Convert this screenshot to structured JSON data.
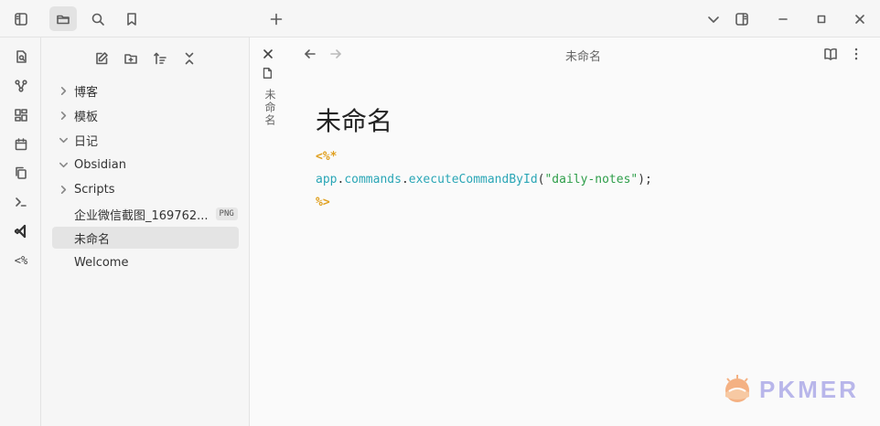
{
  "topbar": {
    "new_tab_label": "+"
  },
  "ribbon": {
    "template_label": "<%"
  },
  "sidebar": {
    "items": [
      {
        "label": "博客",
        "type": "folder",
        "expanded": false
      },
      {
        "label": "模板",
        "type": "folder",
        "expanded": false
      },
      {
        "label": "日记",
        "type": "folder",
        "expanded": true
      },
      {
        "label": "Obsidian",
        "type": "folder",
        "expanded": true
      },
      {
        "label": "Scripts",
        "type": "folder",
        "expanded": false
      },
      {
        "label": "企业微信截图_169762...",
        "type": "file",
        "badge": "PNG"
      },
      {
        "label": "未命名",
        "type": "file",
        "selected": true
      },
      {
        "label": "Welcome",
        "type": "file"
      }
    ]
  },
  "stack": {
    "title": "未命名"
  },
  "editor": {
    "view_title": "未命名",
    "heading": "未命名",
    "code": {
      "open_tag": "<%*",
      "obj": "app",
      "dot1": ".",
      "prop": "commands",
      "dot2": ".",
      "method": "executeCommandById",
      "paren_open": "(",
      "arg": "\"daily-notes\"",
      "paren_close": ");",
      "close_tag": "%>"
    }
  },
  "watermark": {
    "text": "PKMER"
  },
  "colors": {
    "template_tag": "#e0a020",
    "code_identifier": "#2aa6b6",
    "code_string": "#2e9e4a",
    "selected_item_bg": "#e4e4e4"
  }
}
